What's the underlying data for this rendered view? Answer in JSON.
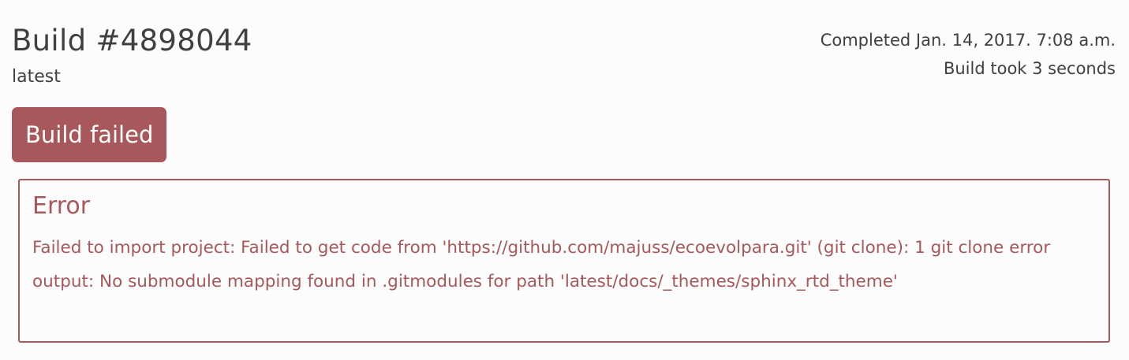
{
  "build": {
    "title": "Build #4898044",
    "version": "latest",
    "completed": "Completed Jan. 14, 2017. 7:08 a.m.",
    "duration": "Build took 3 seconds",
    "status": "Build failed"
  },
  "error": {
    "title": "Error",
    "message": "Failed to import project: Failed to get code from 'https://github.com/majuss/ecoevolpara.git' (git clone): 1 git clone error output: No submodule mapping found in .gitmodules for path 'latest/docs/_themes/sphinx_rtd_theme'"
  },
  "colors": {
    "failed": "#a8575a",
    "text": "#404040",
    "background": "#fcfcfc"
  }
}
